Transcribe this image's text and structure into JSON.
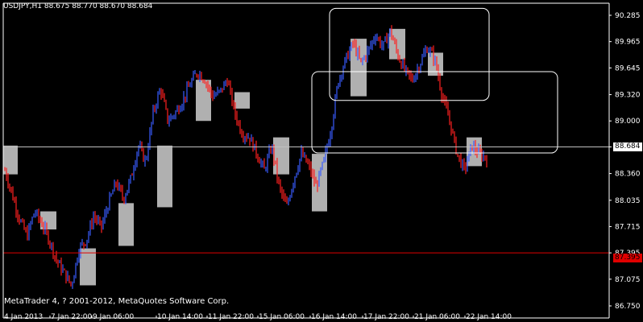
{
  "window": {
    "symbol_label": "USDJPY,H1",
    "ohlc": "88.675 88.770 88.670 88.684",
    "copyright": "MetaTrader 4, ? 2001-2012, MetaQuotes Software Corp."
  },
  "price_axis": {
    "labels": [
      "90.285",
      "89.965",
      "89.645",
      "89.320",
      "89.000",
      "88.684",
      "88.360",
      "88.035",
      "87.715",
      "87.395",
      "87.075",
      "86.750"
    ],
    "current_price": "88.684",
    "horizontal_level": "87.395"
  },
  "time_axis": {
    "labels": [
      "4 Jan 2013",
      "7 Jan 22:00",
      "9 Jan 06:00",
      "10 Jan 14:00",
      "11 Jan 22:00",
      "15 Jan 06:00",
      "16 Jan 14:00",
      "17 Jan 22:00",
      "21 Jan 06:00",
      "22 Jan 14:00"
    ]
  },
  "colors": {
    "background": "#000000",
    "bull_bar": "#3a5cff",
    "bear_bar": "#ff2020",
    "session_box": "#b0b0b0",
    "level_line": "#e00000",
    "bid_line": "#c0c0c0",
    "rectangle_outline": "#ffffff"
  },
  "chart_data": {
    "type": "ohlc",
    "symbol": "USDJPY",
    "timeframe": "H1",
    "ylim": [
      86.75,
      90.43
    ],
    "y_ticks": [
      90.285,
      89.965,
      89.645,
      89.32,
      89.0,
      88.684,
      88.36,
      88.035,
      87.715,
      87.395,
      87.075,
      86.75
    ],
    "x_ticks": [
      "4 Jan 2013",
      "7 Jan 22:00",
      "9 Jan 06:00",
      "10 Jan 14:00",
      "11 Jan 22:00",
      "15 Jan 06:00",
      "16 Jan 14:00",
      "17 Jan 22:00",
      "21 Jan 06:00",
      "22 Jan 14:00"
    ],
    "close_path": [
      88.4,
      88.1,
      87.8,
      87.6,
      87.9,
      87.75,
      87.55,
      87.3,
      87.15,
      87.0,
      87.45,
      87.55,
      87.85,
      87.7,
      88.0,
      88.25,
      88.05,
      88.3,
      88.7,
      88.5,
      89.1,
      89.4,
      89.0,
      89.1,
      89.25,
      89.45,
      89.6,
      89.5,
      89.3,
      89.35,
      89.5,
      89.1,
      88.85,
      88.8,
      88.6,
      88.4,
      88.7,
      88.2,
      87.95,
      88.3,
      88.6,
      88.45,
      88.2,
      88.5,
      88.9,
      89.5,
      89.75,
      89.95,
      89.7,
      89.85,
      90.05,
      89.9,
      90.1,
      89.8,
      89.6,
      89.5,
      89.7,
      89.9,
      89.75,
      89.3,
      89.0,
      88.6,
      88.4,
      88.7,
      88.6,
      88.55
    ],
    "session_ranges": [
      [
        88.35,
        88.7
      ],
      [
        87.68,
        87.9
      ],
      [
        87.0,
        87.45
      ],
      [
        87.48,
        88.0
      ],
      [
        87.95,
        88.7
      ],
      [
        89.0,
        89.5
      ],
      [
        89.15,
        89.35
      ],
      [
        88.35,
        88.8
      ],
      [
        87.9,
        88.6
      ],
      [
        89.3,
        90.0
      ],
      [
        89.75,
        90.12
      ],
      [
        89.55,
        89.83
      ],
      [
        88.45,
        88.8
      ]
    ],
    "levels": {
      "bid": 88.684,
      "horizontal_line": 87.395,
      "rectangles": [
        {
          "price_high": 90.37,
          "price_low": 89.25
        },
        {
          "price_high": 89.6,
          "price_low": 88.61
        }
      ]
    },
    "grid": false
  }
}
